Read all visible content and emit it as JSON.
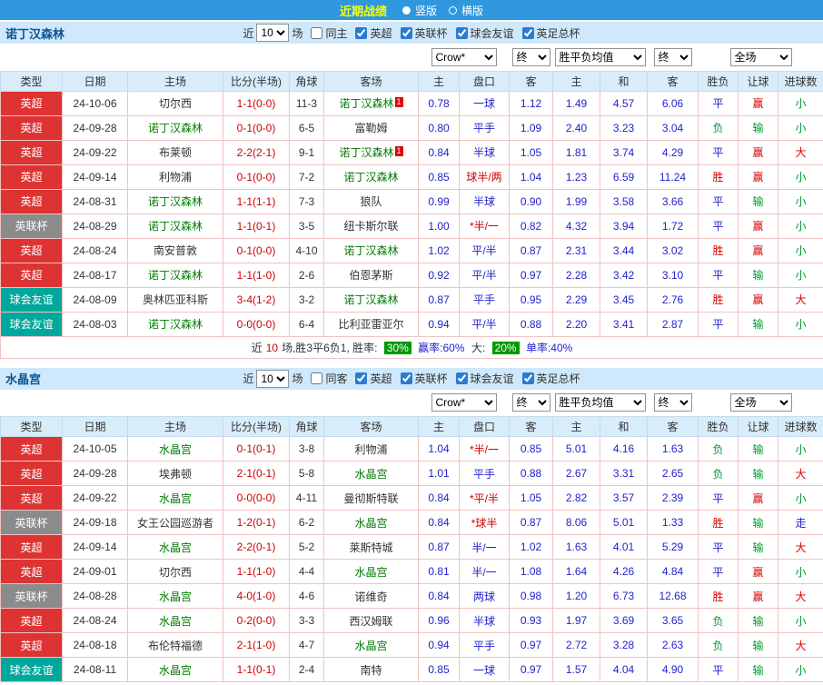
{
  "top_bar": {
    "title": "近期战绩",
    "options": [
      {
        "label": "竖版",
        "selected": true
      },
      {
        "label": "横版",
        "selected": false
      }
    ]
  },
  "colors": {
    "topbar_bg": "#2e97de",
    "type_bg": {
      "英超": "#dd3333",
      "英联杯": "#8b8b8b",
      "球会友谊": "#00a89b"
    },
    "result": {
      "胜": "#dd0000",
      "平": "#2222cc",
      "负": "#009933"
    },
    "cover": {
      "赢": "#dd0000",
      "输": "#009933"
    },
    "goals": {
      "大": "#dd0000",
      "小": "#009933",
      "走": "#2222cc"
    }
  },
  "filter_bar": {
    "recent": "近",
    "count": "10",
    "games": "场",
    "competitions": [
      "英超",
      "英联杯",
      "球会友谊",
      "英足总杯"
    ]
  },
  "dropdowns": {
    "odds_company": "Crow*",
    "final1": "终",
    "avg": "胜平负均值",
    "final2": "终",
    "scope": "全场"
  },
  "columns": {
    "type": "类型",
    "date": "日期",
    "home": "主场",
    "score": "比分(半场)",
    "corner": "角球",
    "away": "客场",
    "odds_home": "主",
    "handicap": "盘口",
    "odds_away": "客",
    "avg_home": "主",
    "avg_draw": "和",
    "avg_away": "客",
    "result": "胜负",
    "cover": "让球",
    "goals": "进球数"
  },
  "sections": [
    {
      "team": "诺丁汉森林",
      "same_label": "同主",
      "rows": [
        {
          "type": "英超",
          "date": "24-10-06",
          "home": "切尔西",
          "home_focus": false,
          "score": "1-1(0-0)",
          "corner": "11-3",
          "away": "诺丁汉森林",
          "away_focus": true,
          "away_card": "1",
          "odds_home": "0.78",
          "handicap": "一球",
          "handicap_red": false,
          "odds_away": "1.12",
          "avg_win": "1.49",
          "avg_draw": "4.57",
          "avg_lose": "6.06",
          "result": "平",
          "cover": "赢",
          "goals": "小"
        },
        {
          "type": "英超",
          "date": "24-09-28",
          "home": "诺丁汉森林",
          "home_focus": true,
          "score": "0-1(0-0)",
          "corner": "6-5",
          "away": "富勒姆",
          "away_focus": false,
          "odds_home": "0.80",
          "handicap": "平手",
          "handicap_red": false,
          "odds_away": "1.09",
          "avg_win": "2.40",
          "avg_draw": "3.23",
          "avg_lose": "3.04",
          "result": "负",
          "cover": "输",
          "goals": "小"
        },
        {
          "type": "英超",
          "date": "24-09-22",
          "home": "布莱顿",
          "home_focus": false,
          "score": "2-2(2-1)",
          "corner": "9-1",
          "away": "诺丁汉森林",
          "away_focus": true,
          "away_card": "1",
          "odds_home": "0.84",
          "handicap": "半球",
          "handicap_red": false,
          "odds_away": "1.05",
          "avg_win": "1.81",
          "avg_draw": "3.74",
          "avg_lose": "4.29",
          "result": "平",
          "cover": "赢",
          "goals": "大"
        },
        {
          "type": "英超",
          "date": "24-09-14",
          "home": "利物浦",
          "home_focus": false,
          "score": "0-1(0-0)",
          "corner": "7-2",
          "away": "诺丁汉森林",
          "away_focus": true,
          "odds_home": "0.85",
          "handicap": "球半/两",
          "handicap_red": true,
          "odds_away": "1.04",
          "avg_win": "1.23",
          "avg_draw": "6.59",
          "avg_lose": "11.24",
          "result": "胜",
          "cover": "赢",
          "goals": "小"
        },
        {
          "type": "英超",
          "date": "24-08-31",
          "home": "诺丁汉森林",
          "home_focus": true,
          "score": "1-1(1-1)",
          "corner": "7-3",
          "away": "狼队",
          "away_focus": false,
          "odds_home": "0.99",
          "handicap": "半球",
          "handicap_red": false,
          "odds_away": "0.90",
          "avg_win": "1.99",
          "avg_draw": "3.58",
          "avg_lose": "3.66",
          "result": "平",
          "cover": "输",
          "goals": "小"
        },
        {
          "type": "英联杯",
          "date": "24-08-29",
          "home": "诺丁汉森林",
          "home_focus": true,
          "score": "1-1(0-1)",
          "corner": "3-5",
          "away": "纽卡斯尔联",
          "away_focus": false,
          "odds_home": "1.00",
          "handicap": "*半/一",
          "handicap_red": true,
          "odds_away": "0.82",
          "avg_win": "4.32",
          "avg_draw": "3.94",
          "avg_lose": "1.72",
          "result": "平",
          "cover": "赢",
          "goals": "小"
        },
        {
          "type": "英超",
          "date": "24-08-24",
          "home": "南安普敦",
          "home_focus": false,
          "score": "0-1(0-0)",
          "corner": "4-10",
          "away": "诺丁汉森林",
          "away_focus": true,
          "odds_home": "1.02",
          "handicap": "平/半",
          "handicap_red": false,
          "odds_away": "0.87",
          "avg_win": "2.31",
          "avg_draw": "3.44",
          "avg_lose": "3.02",
          "result": "胜",
          "cover": "赢",
          "goals": "小"
        },
        {
          "type": "英超",
          "date": "24-08-17",
          "home": "诺丁汉森林",
          "home_focus": true,
          "score": "1-1(1-0)",
          "corner": "2-6",
          "away": "伯恩茅斯",
          "away_focus": false,
          "odds_home": "0.92",
          "handicap": "平/半",
          "handicap_red": false,
          "odds_away": "0.97",
          "avg_win": "2.28",
          "avg_draw": "3.42",
          "avg_lose": "3.10",
          "result": "平",
          "cover": "输",
          "goals": "小"
        },
        {
          "type": "球会友谊",
          "date": "24-08-09",
          "home": "奥林匹亚科斯",
          "home_focus": false,
          "score": "3-4(1-2)",
          "corner": "3-2",
          "away": "诺丁汉森林",
          "away_focus": true,
          "odds_home": "0.87",
          "handicap": "平手",
          "handicap_red": false,
          "odds_away": "0.95",
          "avg_win": "2.29",
          "avg_draw": "3.45",
          "avg_lose": "2.76",
          "result": "胜",
          "cover": "赢",
          "goals": "大"
        },
        {
          "type": "球会友谊",
          "date": "24-08-03",
          "home": "诺丁汉森林",
          "home_focus": true,
          "score": "0-0(0-0)",
          "corner": "6-4",
          "away": "比利亚雷亚尔",
          "away_focus": false,
          "odds_home": "0.94",
          "handicap": "平/半",
          "handicap_red": false,
          "odds_away": "0.88",
          "avg_win": "2.20",
          "avg_draw": "3.41",
          "avg_lose": "2.87",
          "result": "平",
          "cover": "输",
          "goals": "小"
        }
      ],
      "summary": {
        "p1": "近",
        "n1": "10",
        "p2": "场,胜3平6负1, 胜率:",
        "rate1": "30%",
        "p3": "赢率:60%",
        "p4": "大:",
        "rate2": "20%",
        "p5": "单率:40%"
      }
    },
    {
      "team": "水晶宫",
      "same_label": "同客",
      "rows": [
        {
          "type": "英超",
          "date": "24-10-05",
          "home": "水晶宫",
          "home_focus": true,
          "score": "0-1(0-1)",
          "corner": "3-8",
          "away": "利物浦",
          "away_focus": false,
          "odds_home": "1.04",
          "handicap": "*半/一",
          "handicap_red": true,
          "odds_away": "0.85",
          "avg_win": "5.01",
          "avg_draw": "4.16",
          "avg_lose": "1.63",
          "result": "负",
          "cover": "输",
          "goals": "小"
        },
        {
          "type": "英超",
          "date": "24-09-28",
          "home": "埃弗顿",
          "home_focus": false,
          "score": "2-1(0-1)",
          "corner": "5-8",
          "away": "水晶宫",
          "away_focus": true,
          "odds_home": "1.01",
          "handicap": "平手",
          "handicap_red": false,
          "odds_away": "0.88",
          "avg_win": "2.67",
          "avg_draw": "3.31",
          "avg_lose": "2.65",
          "result": "负",
          "cover": "输",
          "goals": "大"
        },
        {
          "type": "英超",
          "date": "24-09-22",
          "home": "水晶宫",
          "home_focus": true,
          "score": "0-0(0-0)",
          "corner": "4-11",
          "away": "曼彻斯特联",
          "away_focus": false,
          "odds_home": "0.84",
          "handicap": "*平/半",
          "handicap_red": true,
          "odds_away": "1.05",
          "avg_win": "2.82",
          "avg_draw": "3.57",
          "avg_lose": "2.39",
          "result": "平",
          "cover": "赢",
          "goals": "小"
        },
        {
          "type": "英联杯",
          "date": "24-09-18",
          "home": "女王公园巡游者",
          "home_focus": false,
          "score": "1-2(0-1)",
          "corner": "6-2",
          "away": "水晶宫",
          "away_focus": true,
          "odds_home": "0.84",
          "handicap": "*球半",
          "handicap_red": true,
          "odds_away": "0.87",
          "avg_win": "8.06",
          "avg_draw": "5.01",
          "avg_lose": "1.33",
          "result": "胜",
          "cover": "输",
          "goals": "走"
        },
        {
          "type": "英超",
          "date": "24-09-14",
          "home": "水晶宫",
          "home_focus": true,
          "score": "2-2(0-1)",
          "corner": "5-2",
          "away": "莱斯特城",
          "away_focus": false,
          "odds_home": "0.87",
          "handicap": "半/一",
          "handicap_red": false,
          "odds_away": "1.02",
          "avg_win": "1.63",
          "avg_draw": "4.01",
          "avg_lose": "5.29",
          "result": "平",
          "cover": "输",
          "goals": "大"
        },
        {
          "type": "英超",
          "date": "24-09-01",
          "home": "切尔西",
          "home_focus": false,
          "score": "1-1(1-0)",
          "corner": "4-4",
          "away": "水晶宫",
          "away_focus": true,
          "odds_home": "0.81",
          "handicap": "半/一",
          "handicap_red": false,
          "odds_away": "1.08",
          "avg_win": "1.64",
          "avg_draw": "4.26",
          "avg_lose": "4.84",
          "result": "平",
          "cover": "赢",
          "goals": "小"
        },
        {
          "type": "英联杯",
          "date": "24-08-28",
          "home": "水晶宫",
          "home_focus": true,
          "score": "4-0(1-0)",
          "corner": "4-6",
          "away": "诺维奇",
          "away_focus": false,
          "odds_home": "0.84",
          "handicap": "两球",
          "handicap_red": false,
          "odds_away": "0.98",
          "avg_win": "1.20",
          "avg_draw": "6.73",
          "avg_lose": "12.68",
          "result": "胜",
          "cover": "赢",
          "goals": "大"
        },
        {
          "type": "英超",
          "date": "24-08-24",
          "home": "水晶宫",
          "home_focus": true,
          "score": "0-2(0-0)",
          "corner": "3-3",
          "away": "西汉姆联",
          "away_focus": false,
          "odds_home": "0.96",
          "handicap": "半球",
          "handicap_red": false,
          "odds_away": "0.93",
          "avg_win": "1.97",
          "avg_draw": "3.69",
          "avg_lose": "3.65",
          "result": "负",
          "cover": "输",
          "goals": "小"
        },
        {
          "type": "英超",
          "date": "24-08-18",
          "home": "布伦特福德",
          "home_focus": false,
          "score": "2-1(1-0)",
          "corner": "4-7",
          "away": "水晶宫",
          "away_focus": true,
          "odds_home": "0.94",
          "handicap": "平手",
          "handicap_red": false,
          "odds_away": "0.97",
          "avg_win": "2.72",
          "avg_draw": "3.28",
          "avg_lose": "2.63",
          "result": "负",
          "cover": "输",
          "goals": "大"
        },
        {
          "type": "球会友谊",
          "date": "24-08-11",
          "home": "水晶宫",
          "home_focus": true,
          "score": "1-1(0-1)",
          "corner": "2-4",
          "away": "南特",
          "away_focus": false,
          "odds_home": "0.85",
          "handicap": "一球",
          "handicap_red": false,
          "odds_away": "0.97",
          "avg_win": "1.57",
          "avg_draw": "4.04",
          "avg_lose": "4.90",
          "result": "平",
          "cover": "输",
          "goals": "小"
        }
      ]
    }
  ]
}
